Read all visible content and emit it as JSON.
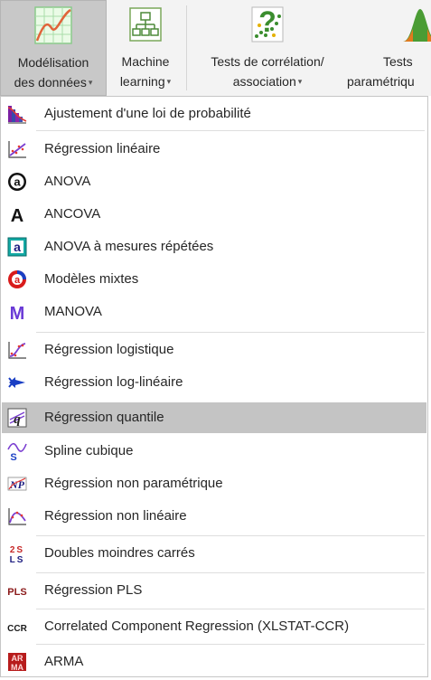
{
  "ribbon": {
    "buttons": [
      {
        "line1": "Modélisation",
        "line2": "des données",
        "caret": "▾",
        "icon": "line-chart-icon"
      },
      {
        "line1": "Machine",
        "line2": "learning",
        "caret": "▾",
        "icon": "network-icon"
      },
      {
        "line1": "Tests de corrélation/",
        "line2": "association",
        "caret": "▾",
        "icon": "correlation-icon"
      },
      {
        "line1": "Tests",
        "line2": "paramétriqu",
        "icon": "bell-curve-icon"
      }
    ]
  },
  "menu": {
    "items": [
      {
        "label": "Ajustement d'une loi de probabilité",
        "icon": "distribution-icon"
      },
      {
        "label": "Régression linéaire",
        "icon": "linear-regression-icon"
      },
      {
        "label": "ANOVA",
        "icon": "anova-icon",
        "glyph": "a"
      },
      {
        "label": "ANCOVA",
        "icon": "ancova-icon",
        "glyph": "A"
      },
      {
        "label": "ANOVA à mesures répétées",
        "icon": "repeated-anova-icon",
        "glyph": "a"
      },
      {
        "label": "Modèles mixtes",
        "icon": "mixed-models-icon",
        "glyph": "a"
      },
      {
        "label": "MANOVA",
        "icon": "manova-icon",
        "glyph": "M"
      },
      {
        "label": "Régression logistique",
        "icon": "logistic-regression-icon"
      },
      {
        "label": "Régression log-linéaire",
        "icon": "log-linear-icon"
      },
      {
        "label": "Régression quantile",
        "icon": "quantile-regression-icon"
      },
      {
        "label": "Spline cubique",
        "icon": "spline-icon",
        "glyph": "S"
      },
      {
        "label": "Régression non paramétrique",
        "icon": "nonparametric-icon",
        "glyph": "NP"
      },
      {
        "label": "Régression non linéaire",
        "icon": "nonlinear-icon"
      },
      {
        "label": "Doubles moindres carrés",
        "icon": "two-stage-ls-icon",
        "glyph": "2S LS"
      },
      {
        "label": "Régression PLS",
        "icon": "pls-icon",
        "glyph": "PLS"
      },
      {
        "label": "Correlated Component Regression (XLSTAT-CCR)",
        "icon": "ccr-icon",
        "glyph": "CCR"
      },
      {
        "label": "ARMA",
        "icon": "arma-icon",
        "glyph": "AR MA"
      }
    ],
    "highlighted_index": 9
  }
}
